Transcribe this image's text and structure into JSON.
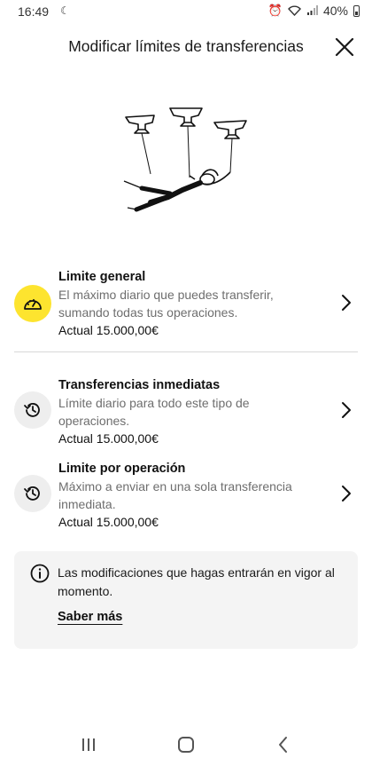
{
  "status_bar": {
    "time": "16:49",
    "battery": "40%"
  },
  "header": {
    "title": "Modificar límites de transferencias"
  },
  "items": [
    {
      "title": "Limite general",
      "description": "El máximo diario que puedes transferir, sumando todas tus operaciones.",
      "current": "Actual 15.000,00€",
      "icon": "gauge-icon"
    },
    {
      "title": "Transferencias inmediatas",
      "description": "Límite diario para todo este tipo de operaciones.",
      "current": "Actual 15.000,00€",
      "icon": "history-clock-icon"
    },
    {
      "title": "Limite por operación",
      "description": "Máximo a enviar en una sola transferencia inmediata.",
      "current": "Actual 15.000,00€",
      "icon": "history-clock-icon"
    }
  ],
  "info": {
    "text": "Las modificaciones que hagas entrarán en vigor al momento.",
    "link": "Saber más"
  },
  "colors": {
    "accent_yellow": "#fde42f",
    "icon_bg": "#eeeeee",
    "info_bg": "#f4f4f4",
    "text_secondary": "#6e6e6e"
  }
}
